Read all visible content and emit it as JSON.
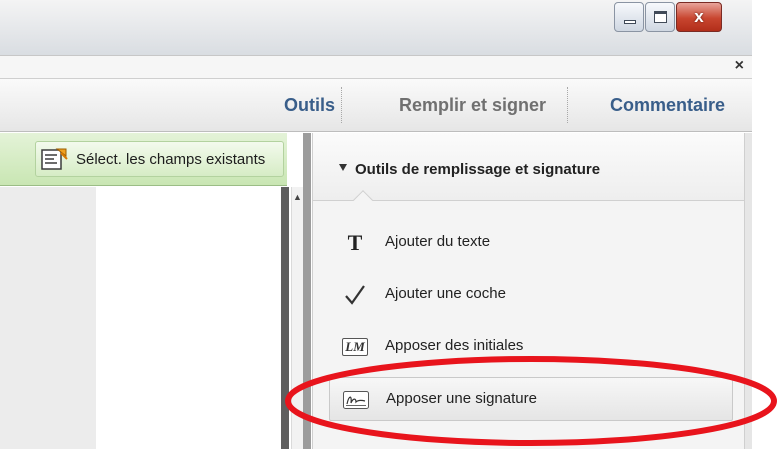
{
  "window": {
    "controls": [
      "minimize-icon",
      "maximize-icon",
      "close-icon"
    ],
    "close_glyph": "x"
  },
  "tabstrip": {
    "close_glyph": "×"
  },
  "toolbar": {
    "tabs": [
      {
        "label": "Outils"
      },
      {
        "label": "Remplir et signer"
      },
      {
        "label": "Commentaire"
      }
    ]
  },
  "left": {
    "select_fields_button": {
      "label": "Sélect. les champs existants",
      "icon": "select-fields-icon"
    }
  },
  "panel": {
    "title": "Outils de remplissage et signature",
    "tools": [
      {
        "label": "Ajouter du texte",
        "icon": "text-icon",
        "glyph": "T"
      },
      {
        "label": "Ajouter une coche",
        "icon": "checkmark-icon",
        "glyph": "✓"
      },
      {
        "label": "Apposer des initiales",
        "icon": "initials-icon",
        "glyph": "LM"
      },
      {
        "label": "Apposer une signature",
        "icon": "signature-icon",
        "glyph": ""
      }
    ],
    "selected_tool": "Apposer une signature"
  },
  "annotation": {
    "color": "#e8141c",
    "shape": "ellipse"
  },
  "colors": {
    "tab_active": "#395e8a",
    "tab_inactive": "#707070",
    "green_bar": "#c9e6b3"
  }
}
